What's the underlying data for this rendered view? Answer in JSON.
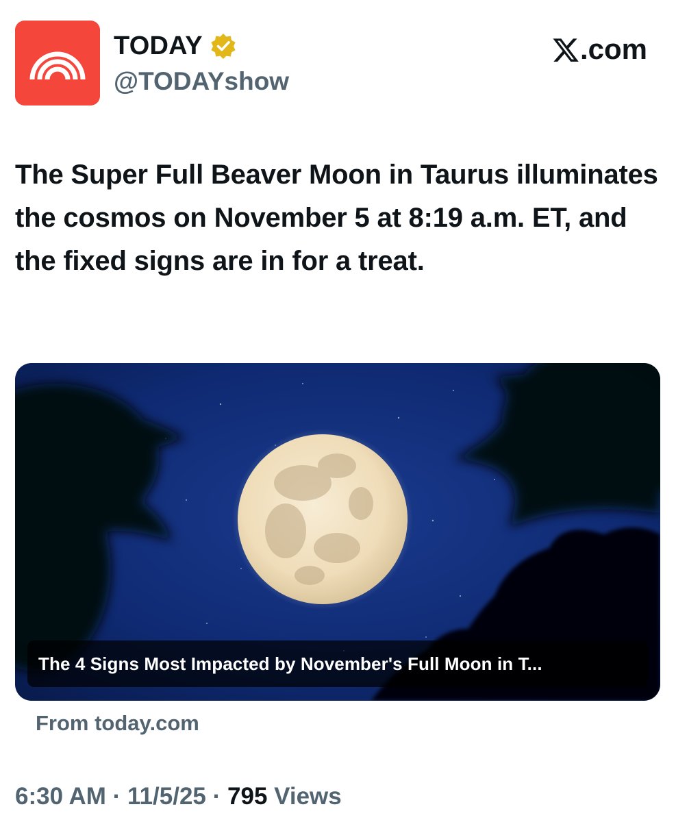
{
  "account": {
    "display_name": "TODAY",
    "handle": "@TODAYshow",
    "avatar_icon": "today-rainbow-logo-icon",
    "verified_icon": "gold-verified-badge-icon",
    "colors": {
      "avatar_bg": "#f5463c",
      "badge": "#e2b719"
    }
  },
  "brand": {
    "logo_icon": "x-logo-icon",
    "suffix": ".com"
  },
  "tweet": {
    "text": "The Super Full Beaver Moon in Taurus illuminates the cosmos on November 5 at 8:19 a.m. ET, and the fixed signs are in for a treat."
  },
  "card": {
    "image_icon": "full-moon-night-sky-photo",
    "caption": "The 4 Signs Most Impacted by November's Full Moon in T...",
    "source": "From today.com"
  },
  "meta": {
    "time": "6:30 AM",
    "separator": "·",
    "date": "11/5/25",
    "views_count": "795",
    "views_label": "Views"
  }
}
